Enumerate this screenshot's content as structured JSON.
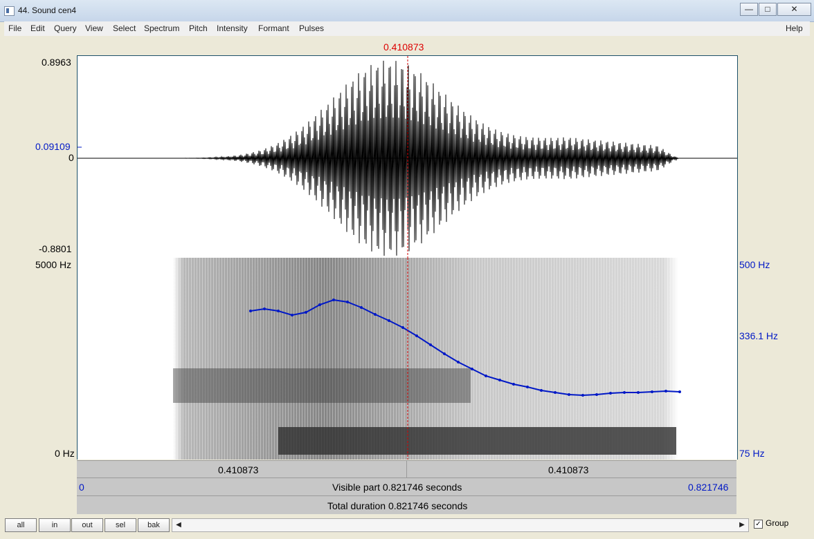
{
  "window": {
    "title": "44. Sound cen4",
    "buttons": [
      "—",
      "□",
      "✕"
    ]
  },
  "menu": {
    "items": [
      "File",
      "Edit",
      "Query",
      "View",
      "Select",
      "Spectrum",
      "Pitch",
      "Intensity",
      "Formant",
      "Pulses"
    ],
    "help": "Help"
  },
  "cursor": {
    "time": "0.410873"
  },
  "waveform": {
    "ymax": "0.8963",
    "marker": "0.09109",
    "zero": "0",
    "ymin": "-0.8801"
  },
  "spectrogram": {
    "freq_top": "5000 Hz",
    "freq_bottom": "0 Hz",
    "pitch_top": "500 Hz",
    "pitch_mid": "336.1 Hz",
    "pitch_bottom": "75 Hz"
  },
  "time_bars": {
    "left_segment": "0.410873",
    "right_segment": "0.410873",
    "start": "0",
    "visible": "Visible part 0.821746 seconds",
    "end": "0.821746",
    "total": "Total duration 0.821746 seconds"
  },
  "bottom": {
    "buttons": [
      "all",
      "in",
      "out",
      "sel",
      "bak"
    ],
    "group_label": "Group",
    "group_checked": "✓"
  },
  "colors": {
    "pitch": "#0018c6",
    "cursor": "#d00000"
  }
}
